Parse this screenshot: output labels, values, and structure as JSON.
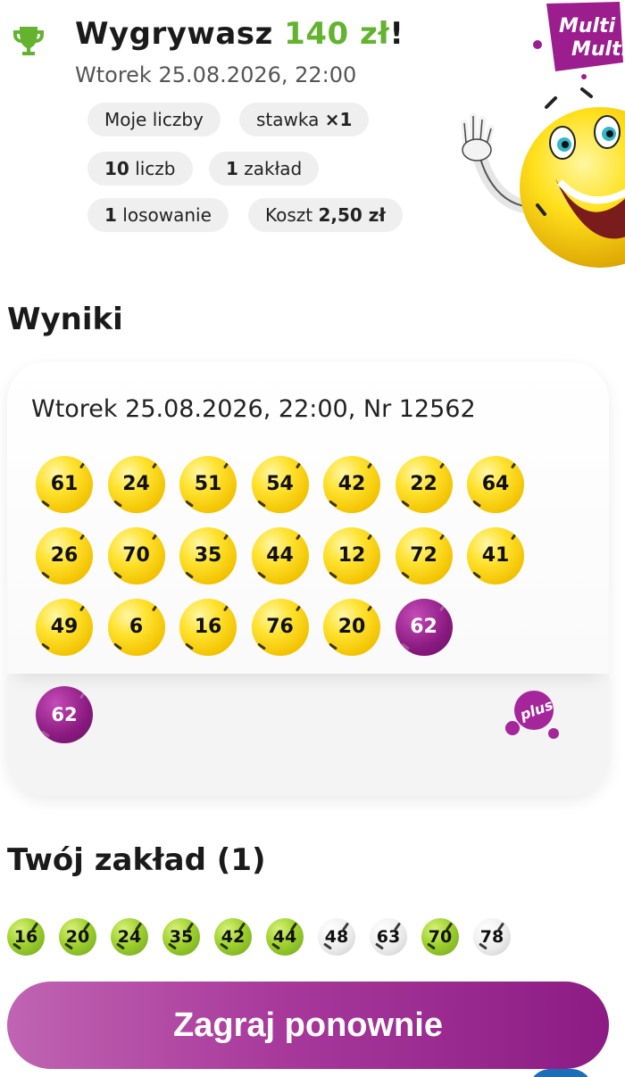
{
  "header": {
    "win_prefix": "Wygrywasz ",
    "win_amount": "140 zł",
    "win_suffix": "!",
    "draw_datetime": "Wtorek 25.08.2026, 22:00",
    "logo_text_top": "Multi",
    "logo_text_bottom": "Multi"
  },
  "chips": {
    "my_numbers": "Moje liczby",
    "stake_prefix": "stawka ",
    "stake_value": "×1",
    "numbers_count": "10",
    "numbers_label": " liczb",
    "bets_count": "1",
    "bets_label": " zakład",
    "draws_count": "1",
    "draws_label": " losowanie",
    "cost_label": "Koszt ",
    "cost_value": "2,50 zł"
  },
  "results": {
    "heading": "Wyniki",
    "draw_line": "Wtorek 25.08.2026, 22:00, Nr 12562",
    "balls": [
      "61",
      "24",
      "51",
      "54",
      "42",
      "22",
      "64",
      "26",
      "70",
      "35",
      "44",
      "12",
      "72",
      "41",
      "49",
      "6",
      "16",
      "76",
      "20",
      "62"
    ],
    "special_ball": "62",
    "plus_ball": "62",
    "plus_logo_text": "plus"
  },
  "bet": {
    "heading": "Twój zakład (1)",
    "numbers": [
      {
        "n": "16",
        "hit": true
      },
      {
        "n": "20",
        "hit": true
      },
      {
        "n": "24",
        "hit": true
      },
      {
        "n": "35",
        "hit": true
      },
      {
        "n": "42",
        "hit": true
      },
      {
        "n": "44",
        "hit": true
      },
      {
        "n": "48",
        "hit": false
      },
      {
        "n": "63",
        "hit": false
      },
      {
        "n": "70",
        "hit": true
      },
      {
        "n": "78",
        "hit": false
      }
    ]
  },
  "cta": {
    "label": "Zagraj ponownie"
  },
  "colors": {
    "win_green": "#63b32e",
    "brand_purple": "#8c1c84",
    "ball_yellow": "#ffe22e"
  }
}
